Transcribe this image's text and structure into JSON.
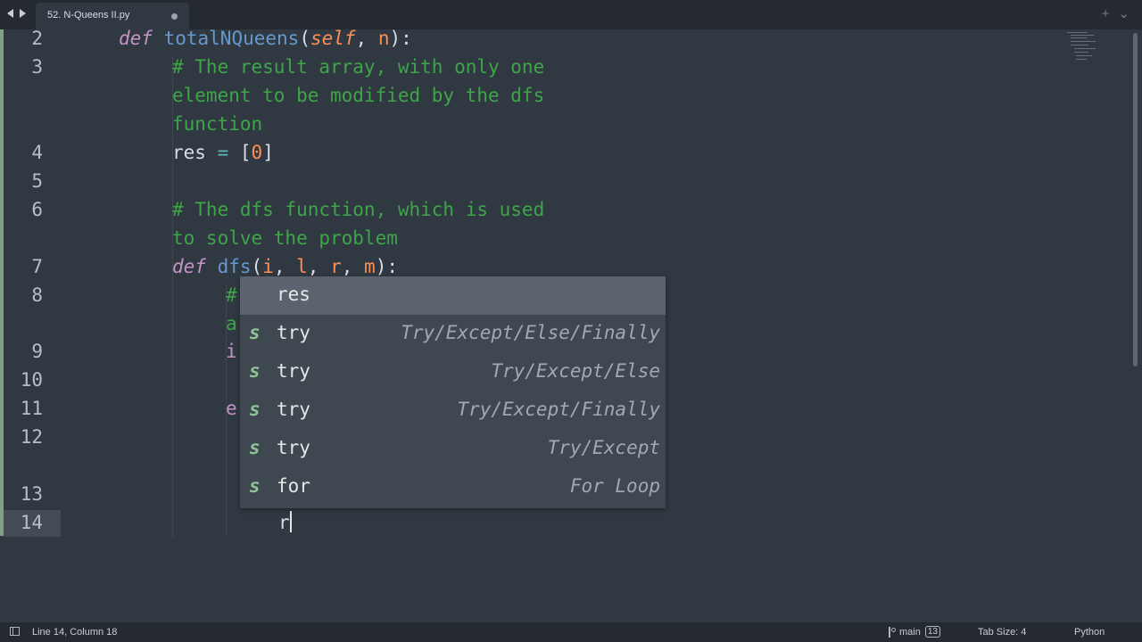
{
  "tabs": [
    {
      "label": "52. N-Queens II.py",
      "modified": true
    }
  ],
  "tab_actions": {
    "new_tab": "+",
    "overflow": "⌄"
  },
  "editor": {
    "line_numbers": [
      "2",
      "3",
      "4",
      "5",
      "6",
      "7",
      "8",
      "9",
      "10",
      "11",
      "12",
      "13",
      "14"
    ],
    "active_line": "14",
    "code": {
      "l2_kw": "def",
      "l2_fn": "totalNQueens",
      "l2_open": "(",
      "l2_self": "self",
      "l2_comma": ", ",
      "l2_n": "n",
      "l2_close": "):",
      "l3_c1": "# The result array, with only one",
      "l3_c2": "element to be modified by the dfs",
      "l3_c3": "function",
      "l4_var": "res",
      "l4_eq": " = ",
      "l4_lb": "[",
      "l4_num": "0",
      "l4_rb": "]",
      "l6_c1": "# The dfs function, which is used",
      "l6_c2": "to solve the problem",
      "l7_kw": "def",
      "l7_fn": "dfs",
      "l7_open": "(",
      "l7_i": "i",
      "l7_l": "l",
      "l7_r": "r",
      "l7_m": "m",
      "l7_sep": ", ",
      "l7_close": "):",
      "l8_frag": "#",
      "l8b_frag": "a",
      "l9_frag": "i",
      "l11_frag": "e",
      "l14_typed": "r"
    }
  },
  "autocomplete": {
    "items": [
      {
        "kind": "",
        "trigger": "res",
        "desc": "",
        "selected": true
      },
      {
        "kind": "s",
        "trigger": "try",
        "desc": "Try/Except/Else/Finally",
        "selected": false
      },
      {
        "kind": "s",
        "trigger": "try",
        "desc": "Try/Except/Else",
        "selected": false
      },
      {
        "kind": "s",
        "trigger": "try",
        "desc": "Try/Except/Finally",
        "selected": false
      },
      {
        "kind": "s",
        "trigger": "try",
        "desc": "Try/Except",
        "selected": false
      },
      {
        "kind": "s",
        "trigger": "for",
        "desc": "For Loop",
        "selected": false
      }
    ]
  },
  "statusbar": {
    "position": "Line 14, Column 18",
    "branch": "main",
    "branch_badge": "13",
    "tab_size": "Tab Size: 4",
    "syntax": "Python"
  },
  "colors": {
    "background": "#303841",
    "keyword": "#c594c5",
    "function": "#6699cc",
    "parameter": "#f99157",
    "comment": "#3ea549",
    "operator": "#5fb4b4"
  },
  "icons": {
    "nav_back": "arrow-left-icon",
    "nav_forward": "arrow-right-icon",
    "modified": "dot-icon",
    "panel": "panel-toggle-icon",
    "branch": "git-branch-icon",
    "snippet": "snippet-s-icon"
  }
}
